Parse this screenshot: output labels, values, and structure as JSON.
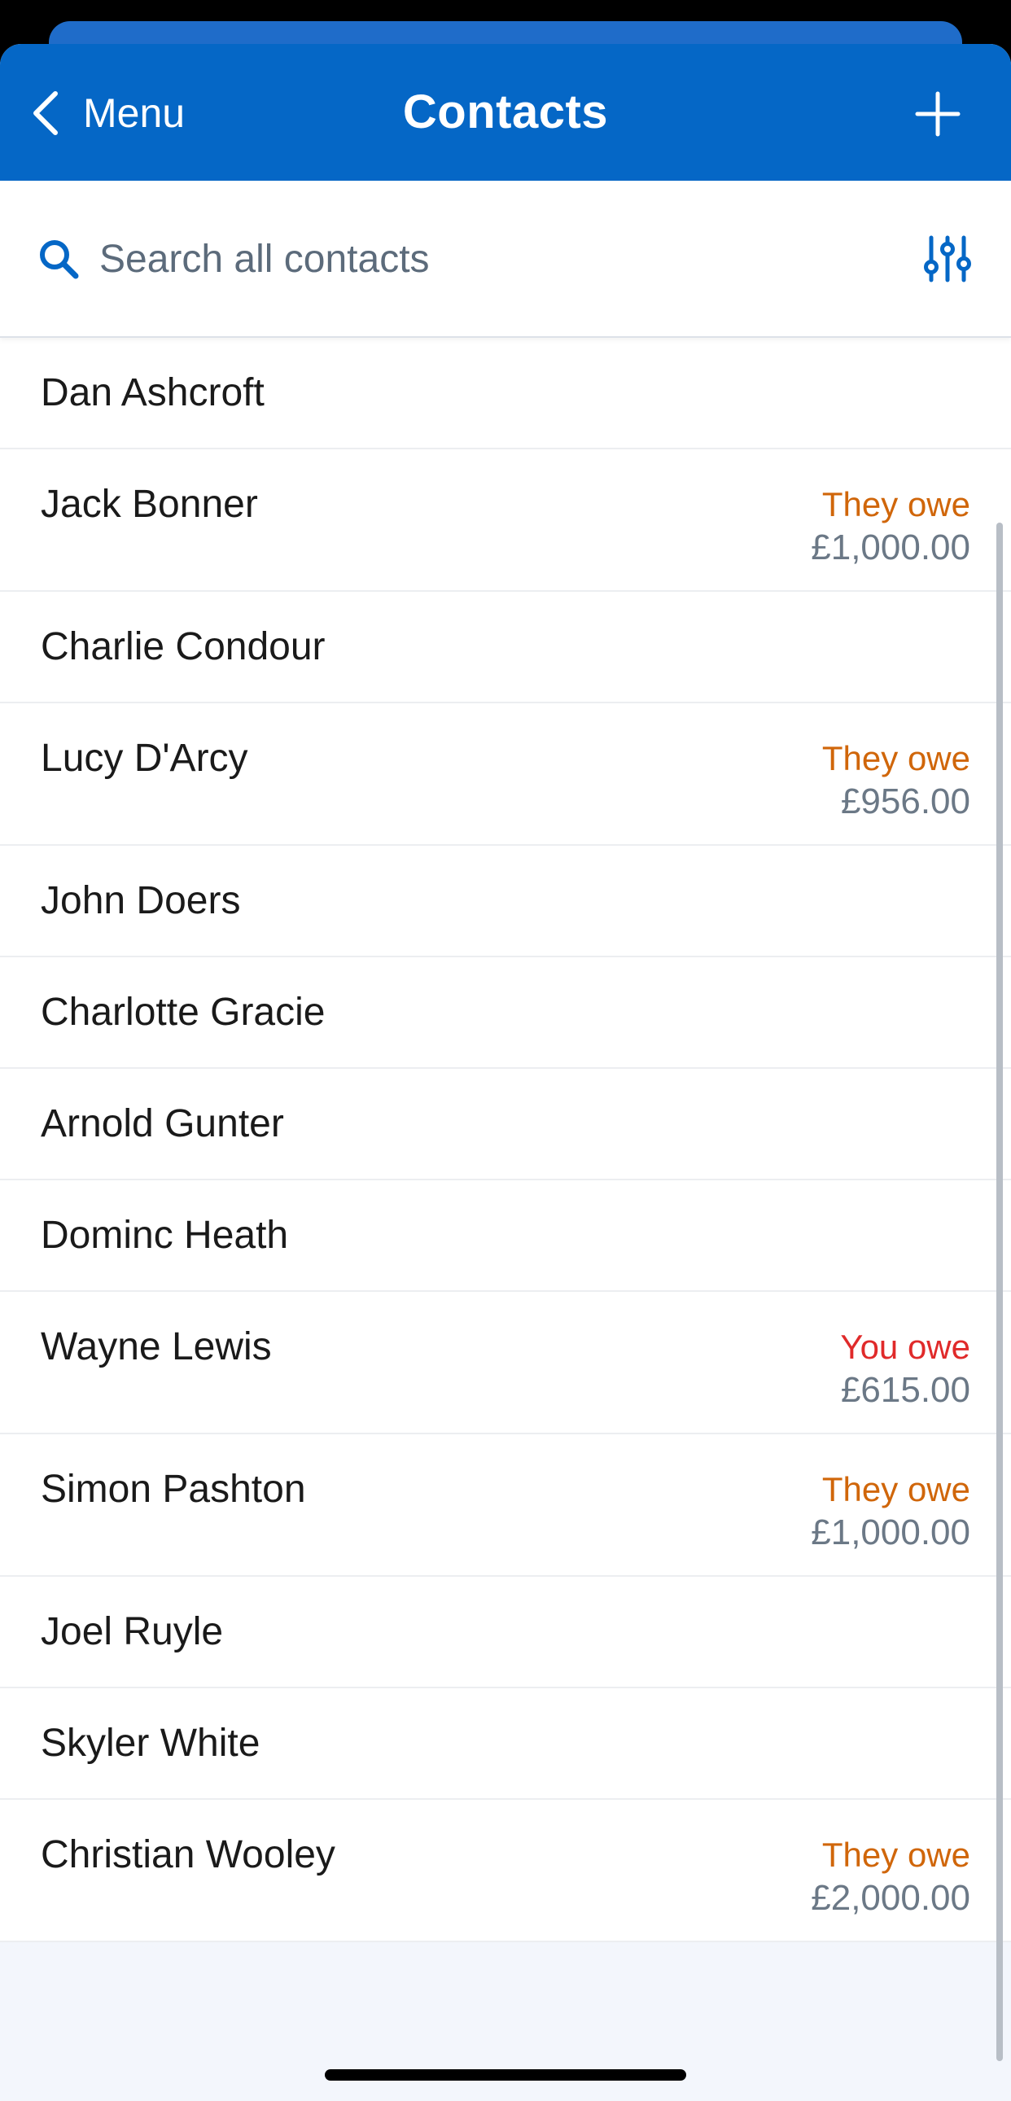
{
  "nav": {
    "back_label": "Menu",
    "title": "Contacts"
  },
  "search": {
    "placeholder": "Search all contacts"
  },
  "colors": {
    "brand": "#0567c6",
    "they_owe": "#d0660a",
    "you_owe": "#e02a2a"
  },
  "icons": {
    "back": "chevron-left-icon",
    "add": "plus-icon",
    "search": "search-icon",
    "filter": "sliders-icon"
  },
  "contacts": [
    {
      "name": "Dan Ashcroft",
      "status": "",
      "amount": ""
    },
    {
      "name": "Jack Bonner",
      "status": "They owe",
      "amount": "£1,000.00"
    },
    {
      "name": "Charlie Condour",
      "status": "",
      "amount": ""
    },
    {
      "name": "Lucy D'Arcy",
      "status": "They owe",
      "amount": "£956.00"
    },
    {
      "name": "John Doers",
      "status": "",
      "amount": ""
    },
    {
      "name": "Charlotte Gracie",
      "status": "",
      "amount": ""
    },
    {
      "name": "Arnold Gunter",
      "status": "",
      "amount": ""
    },
    {
      "name": "Dominc Heath",
      "status": "",
      "amount": ""
    },
    {
      "name": "Wayne Lewis",
      "status": "You owe",
      "amount": "£615.00"
    },
    {
      "name": "Simon Pashton",
      "status": "They owe",
      "amount": "£1,000.00"
    },
    {
      "name": "Joel Ruyle",
      "status": "",
      "amount": ""
    },
    {
      "name": "Skyler White",
      "status": "",
      "amount": ""
    },
    {
      "name": "Christian Wooley",
      "status": "They owe",
      "amount": "£2,000.00"
    }
  ]
}
